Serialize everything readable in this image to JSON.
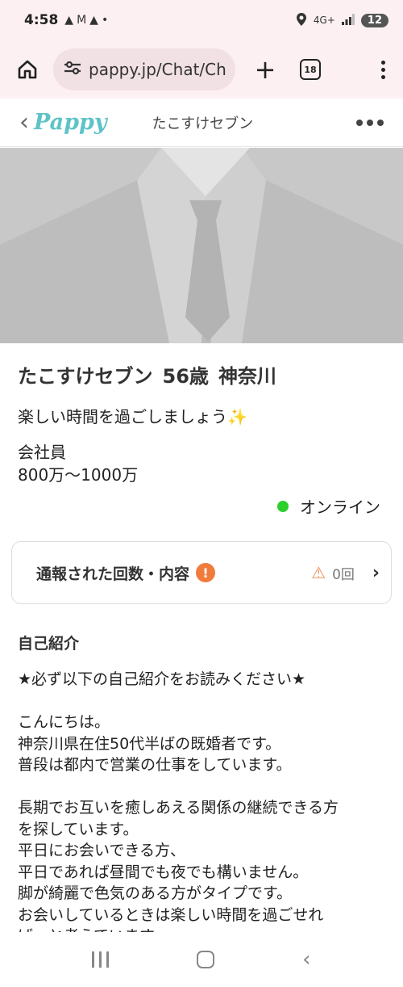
{
  "status_bar": {
    "time": "4:58",
    "notifications": [
      "▲",
      "M",
      "▲",
      "•"
    ],
    "network": "4G+",
    "battery": "12"
  },
  "browser": {
    "url": "pappy.jp/Chat/Ch",
    "tab_count": "18"
  },
  "app_header": {
    "logo": "Pappy",
    "title": "たこすけセブン"
  },
  "profile": {
    "name": "たこすけセブン",
    "age": "56歳",
    "area": "神奈川",
    "catchphrase": "楽しい時間を過ごしましょう✨",
    "occupation": "会社員",
    "income": "800万〜1000万",
    "online_status": "オンライン"
  },
  "report": {
    "label": "通報された回数・内容",
    "alert_icon": "!",
    "count": "0回"
  },
  "intro": {
    "title": "自己紹介",
    "lines": [
      "★必ず以下の自己紹介をお読みください★",
      "",
      "こんにちは。",
      "神奈川県在住50代半ばの既婚者です。",
      "普段は都内で営業の仕事をしています。",
      "",
      "長期でお互いを癒しあえる関係の継続できる方",
      "を探しています。",
      "平日にお会いできる方、",
      "平日であれば昼間でも夜でも構いません。",
      "脚が綺麗で色気のある方がタイプです。",
      "お会いしているときは楽しい時間を過ごせれ",
      "ばーと考えています"
    ]
  },
  "colors": {
    "logo": "#5ec3c6",
    "online": "#2dcf2d",
    "alert": "#f07c3c",
    "chrome_bg": "#fdf0f2"
  }
}
